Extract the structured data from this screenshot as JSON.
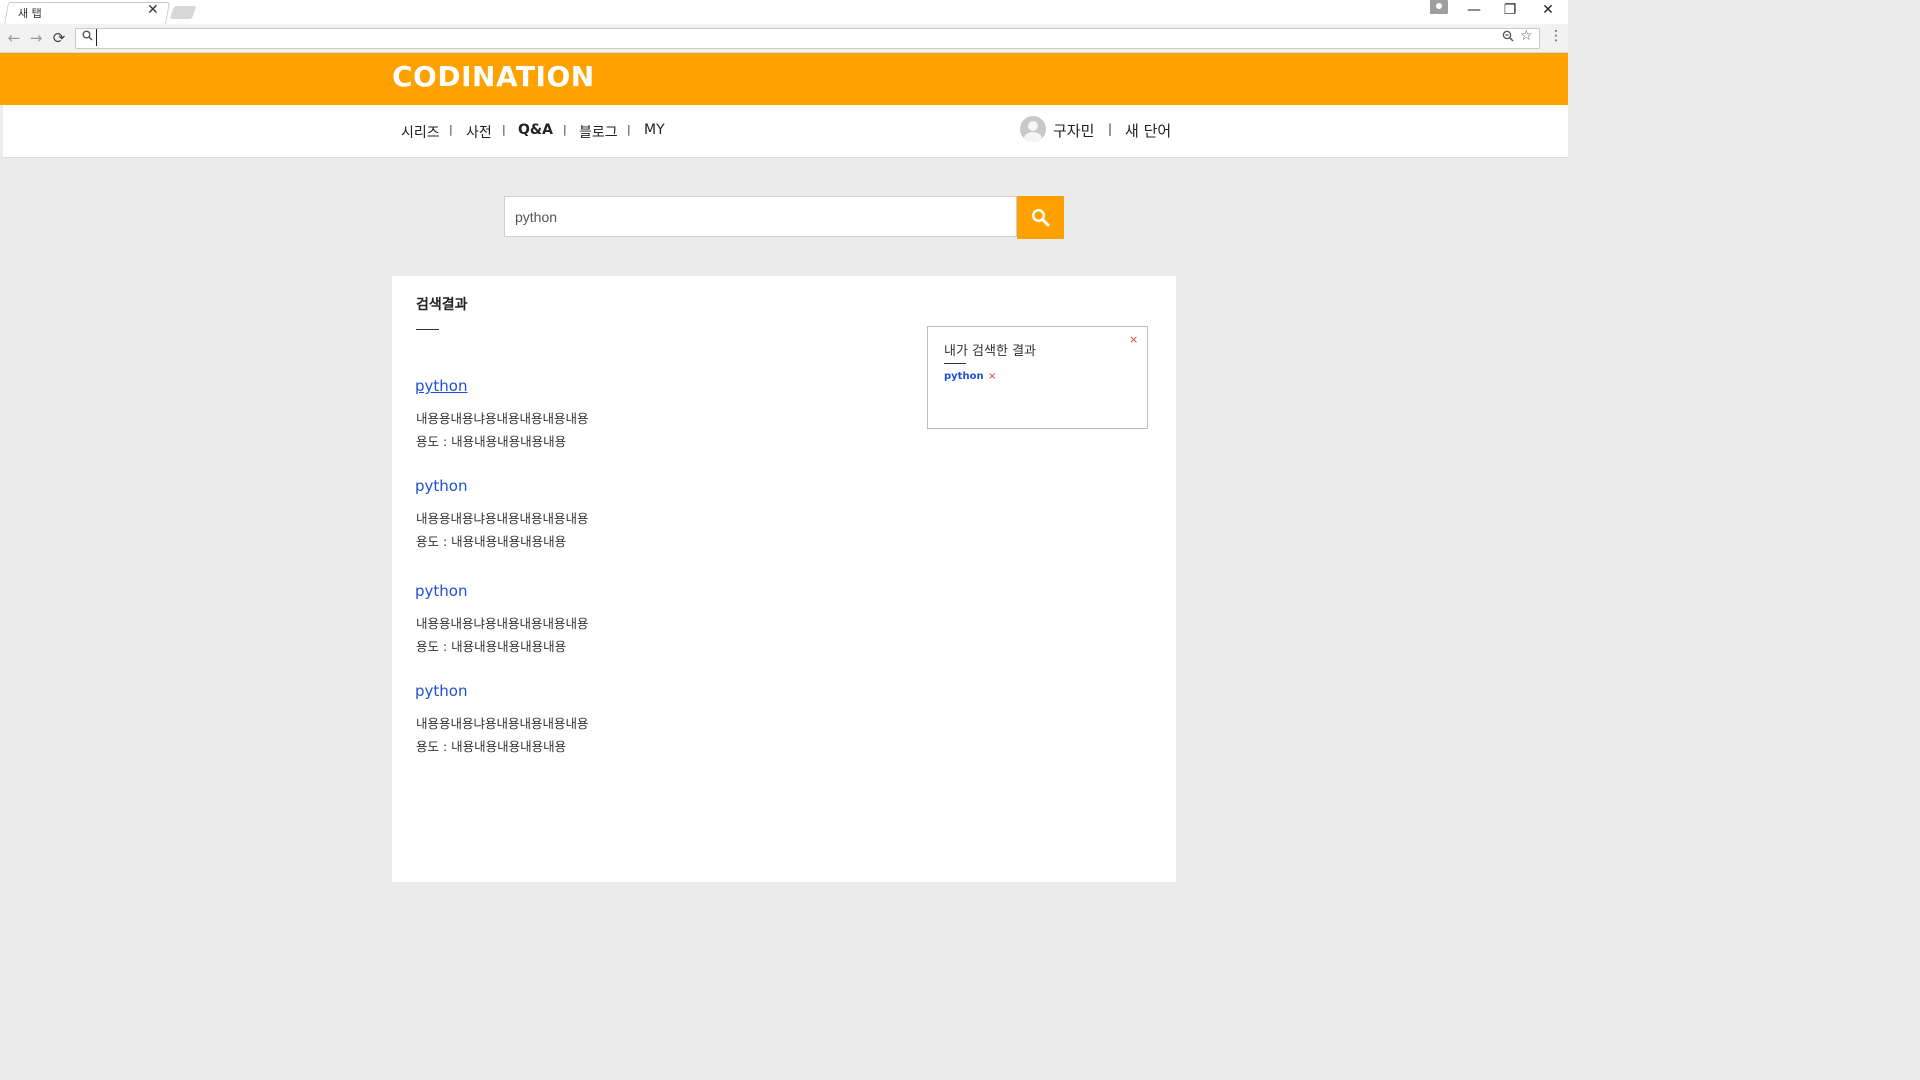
{
  "browser": {
    "tab_title": "새 탭",
    "tab_close": "✕",
    "address_value": "",
    "window": {
      "minimize": "—",
      "restore": "❐",
      "close": "✕"
    },
    "nav": {
      "back": "←",
      "forward": "→",
      "reload": "⟳"
    },
    "icons": {
      "search": "🔍",
      "zoom": "🔍",
      "star": "☆",
      "menu": "⋮"
    }
  },
  "site": {
    "logo": "CODINATION",
    "brand_color": "#ffa200",
    "nav": {
      "series": "시리즈",
      "dictionary": "사전",
      "qna": "Q&A",
      "blog": "블로그",
      "my": "MY",
      "separator": "|"
    },
    "user": {
      "name": "구자민",
      "separator": "|",
      "new_word": "새 단어"
    }
  },
  "search": {
    "query": "python",
    "button_icon": "search-icon"
  },
  "results": {
    "heading": "검색결과",
    "items": [
      {
        "title": "python",
        "line1": "내용용내용냐용내용내용내용내용",
        "line2": "용도 : 내용내용내용내용내용"
      },
      {
        "title": "python",
        "line1": "내용용내용냐용내용내용내용내용",
        "line2": "용도 : 내용내용내용내용내용"
      },
      {
        "title": "python",
        "line1": "내용용내용냐용내용내용내용내용",
        "line2": "용도 : 내용내용내용내용내용"
      },
      {
        "title": "python",
        "line1": "내용용내용냐용내용내용내용내용",
        "line2": "용도 : 내용내용내용내용내용"
      }
    ]
  },
  "history": {
    "title": "내가 검색한 결과",
    "close": "×",
    "item": "python",
    "item_remove": "×"
  }
}
